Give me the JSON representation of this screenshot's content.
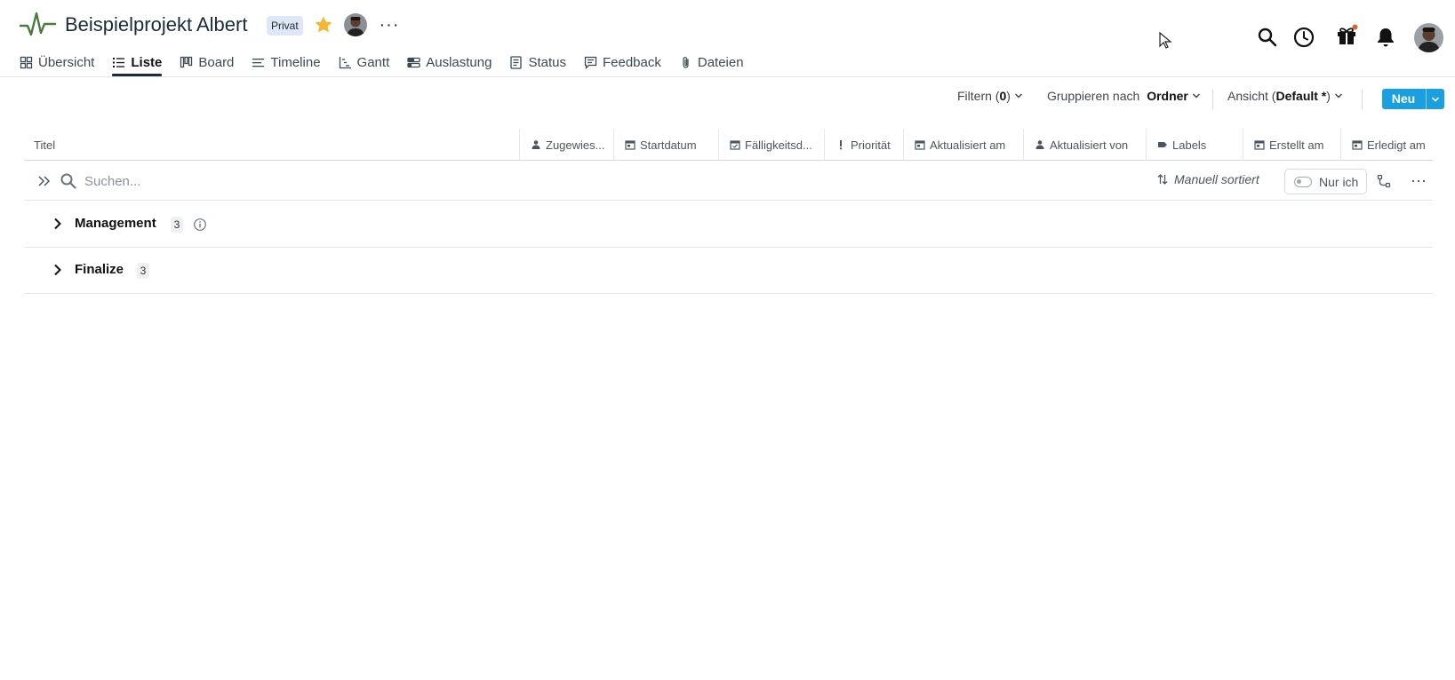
{
  "header": {
    "project_title": "Beispielprojekt Albert",
    "privacy_badge": "Privat",
    "more_label": "···"
  },
  "tabs": [
    {
      "label": "Übersicht",
      "icon": "overview-icon",
      "active": false
    },
    {
      "label": "Liste",
      "icon": "list-icon",
      "active": true
    },
    {
      "label": "Board",
      "icon": "board-icon",
      "active": false
    },
    {
      "label": "Timeline",
      "icon": "timeline-icon",
      "active": false
    },
    {
      "label": "Gantt",
      "icon": "gantt-icon",
      "active": false
    },
    {
      "label": "Auslastung",
      "icon": "workload-icon",
      "active": false
    },
    {
      "label": "Status",
      "icon": "status-icon",
      "active": false
    },
    {
      "label": "Feedback",
      "icon": "feedback-icon",
      "active": false
    },
    {
      "label": "Dateien",
      "icon": "paperclip-icon",
      "active": false
    }
  ],
  "toolbar": {
    "filter_prefix": "Filtern (",
    "filter_count": "0",
    "filter_suffix": ")",
    "group_prefix": "Gruppieren nach ",
    "group_value": "Ordner",
    "view_prefix": "Ansicht (",
    "view_value": "Default *",
    "view_suffix": ")",
    "new_label": "Neu"
  },
  "columns": [
    {
      "label": "Titel",
      "icon": ""
    },
    {
      "label": "Zugewies...",
      "icon": "person-icon"
    },
    {
      "label": "Startdatum",
      "icon": "calendar-icon"
    },
    {
      "label": "Fälligkeitsd...",
      "icon": "calendar-check-icon"
    },
    {
      "label": "Priorität",
      "icon": "exclamation-icon"
    },
    {
      "label": "Aktualisiert am",
      "icon": "calendar-icon"
    },
    {
      "label": "Aktualisiert von",
      "icon": "person-icon"
    },
    {
      "label": "Labels",
      "icon": "label-icon"
    },
    {
      "label": "Erstellt am",
      "icon": "calendar-icon"
    },
    {
      "label": "Erledigt am",
      "icon": "calendar-icon"
    }
  ],
  "search": {
    "placeholder": "Suchen...",
    "sort_label": "Manuell sortiert",
    "only_me_label": "Nur ich"
  },
  "groups": [
    {
      "name": "Management",
      "count": "3",
      "has_info": true
    },
    {
      "name": "Finalize",
      "count": "3",
      "has_info": false
    }
  ],
  "colors": {
    "accent": "#1a9fe0",
    "star": "#f5b731",
    "logo": "#4a7a3d",
    "notification_dot": "#e0632a"
  }
}
